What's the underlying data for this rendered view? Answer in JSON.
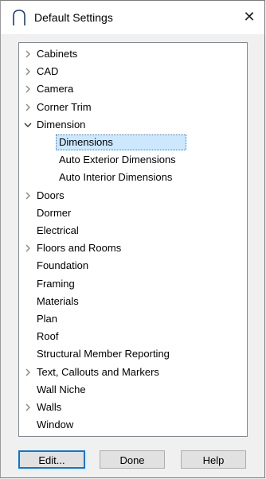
{
  "window": {
    "title": "Default Settings",
    "close_glyph": "✕",
    "title_icon": "arc-door-icon"
  },
  "tree": {
    "items": [
      {
        "label": "Cabinets",
        "expander": "collapsed",
        "level": 0
      },
      {
        "label": "CAD",
        "expander": "collapsed",
        "level": 0
      },
      {
        "label": "Camera",
        "expander": "collapsed",
        "level": 0
      },
      {
        "label": "Corner Trim",
        "expander": "collapsed",
        "level": 0
      },
      {
        "label": "Dimension",
        "expander": "expanded",
        "level": 0
      },
      {
        "label": "Dimensions",
        "expander": "none",
        "level": 1,
        "selected": true
      },
      {
        "label": "Auto Exterior Dimensions",
        "expander": "none",
        "level": 1
      },
      {
        "label": "Auto Interior Dimensions",
        "expander": "none",
        "level": 1
      },
      {
        "label": "Doors",
        "expander": "collapsed",
        "level": 0
      },
      {
        "label": "Dormer",
        "expander": "none",
        "level": 0
      },
      {
        "label": "Electrical",
        "expander": "none",
        "level": 0
      },
      {
        "label": "Floors and Rooms",
        "expander": "collapsed",
        "level": 0
      },
      {
        "label": "Foundation",
        "expander": "none",
        "level": 0
      },
      {
        "label": "Framing",
        "expander": "none",
        "level": 0
      },
      {
        "label": "Materials",
        "expander": "none",
        "level": 0
      },
      {
        "label": "Plan",
        "expander": "none",
        "level": 0
      },
      {
        "label": "Roof",
        "expander": "none",
        "level": 0
      },
      {
        "label": "Structural Member Reporting",
        "expander": "none",
        "level": 0
      },
      {
        "label": "Text, Callouts and Markers",
        "expander": "collapsed",
        "level": 0
      },
      {
        "label": "Wall Niche",
        "expander": "none",
        "level": 0
      },
      {
        "label": "Walls",
        "expander": "collapsed",
        "level": 0
      },
      {
        "label": "Window",
        "expander": "none",
        "level": 0
      }
    ]
  },
  "buttons": {
    "edit": "Edit...",
    "done": "Done",
    "help": "Help"
  },
  "colors": {
    "selection_bg": "#cce8ff",
    "default_button_border": "#0078d7"
  }
}
